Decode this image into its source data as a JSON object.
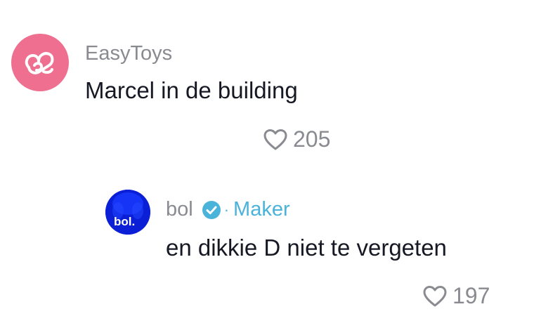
{
  "comments": [
    {
      "username": "EasyToys",
      "text": "Marcel in de building",
      "likes": "205",
      "avatar_icon": "easytoys-logo-icon",
      "avatar_color": "#ee6f8f"
    }
  ],
  "reply": {
    "username": "bol",
    "badge": "Maker",
    "separator": "·",
    "text": "en dikkie D niet te vergeten",
    "likes": "197",
    "avatar_label": "bol.",
    "avatar_color": "#0a1fd6",
    "verified_color": "#4ab3d9"
  }
}
